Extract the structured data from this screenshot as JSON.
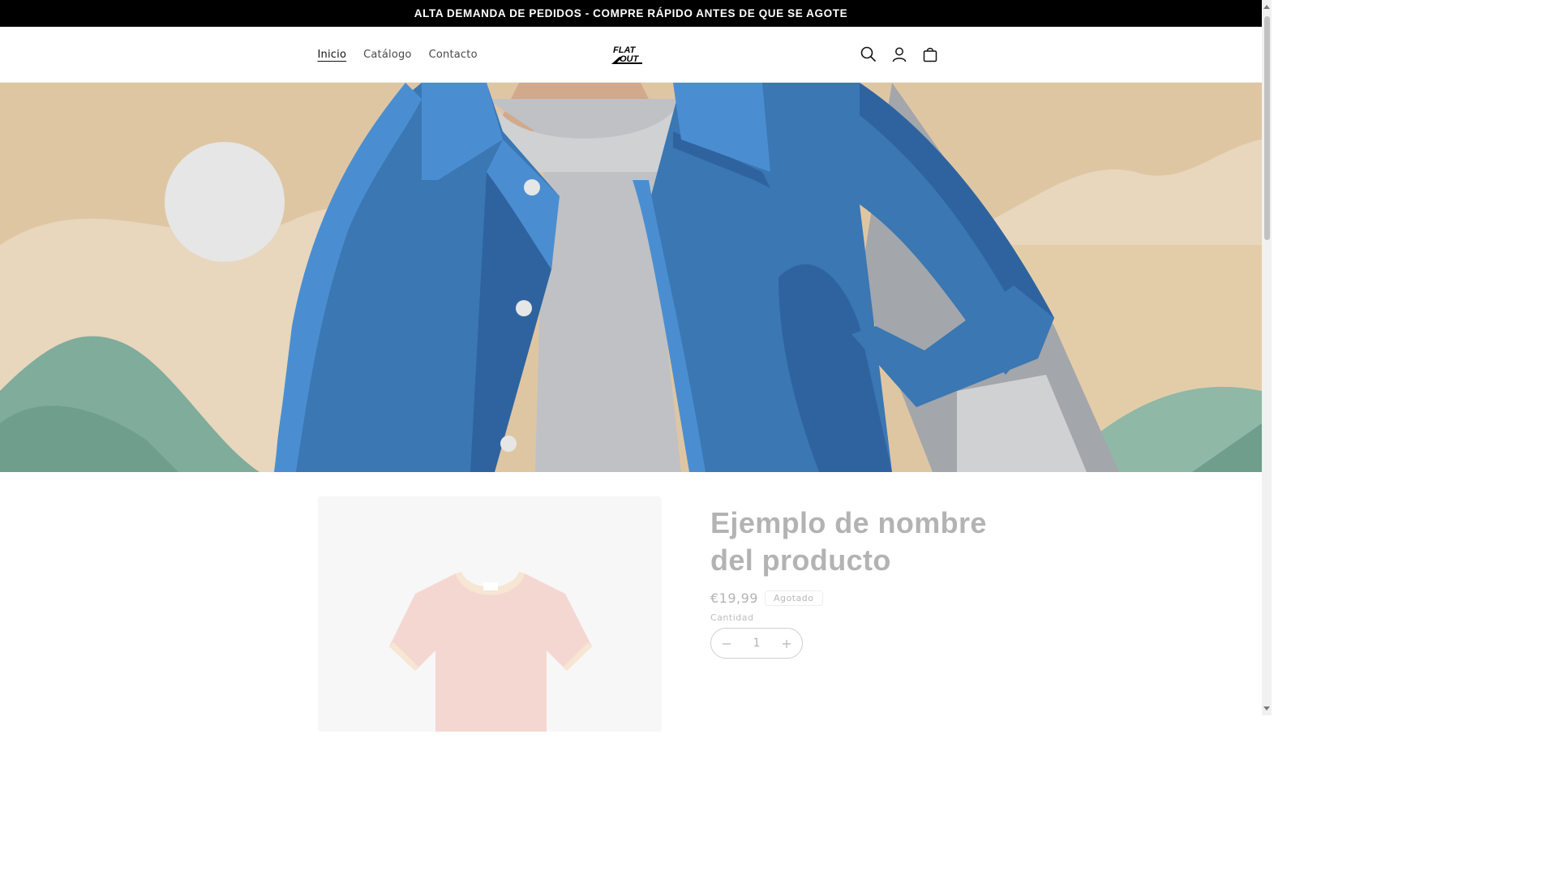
{
  "announcement": {
    "text": "ALTA DEMANDA DE PEDIDOS - COMPRE RÁPIDO ANTES DE QUE SE AGOTE"
  },
  "header": {
    "nav": [
      {
        "label": "Inicio",
        "active": true
      },
      {
        "label": "Catálogo",
        "active": false
      },
      {
        "label": "Contacto",
        "active": false
      }
    ],
    "logo": {
      "text_line1": "FLAT",
      "text_line2": "OUT"
    },
    "icons": [
      "search-icon",
      "account-icon",
      "cart-icon"
    ]
  },
  "product": {
    "title": "Ejemplo de nombre del producto",
    "price": "€19,99",
    "badge": "Agotado",
    "quantity_label": "Cantidad",
    "quantity_value": "1",
    "decrease_symbol": "−",
    "increase_symbol": "+"
  },
  "colors": {
    "announcement_bg": "#000000",
    "hero_bg": "#dfc6a3",
    "jacket": "#3a77b3",
    "jacket_dark": "#2f63a0",
    "shirt_gray": "#bfc1c4",
    "hills_green": "#7fac9b",
    "muted_text": "#b3b3b3"
  }
}
